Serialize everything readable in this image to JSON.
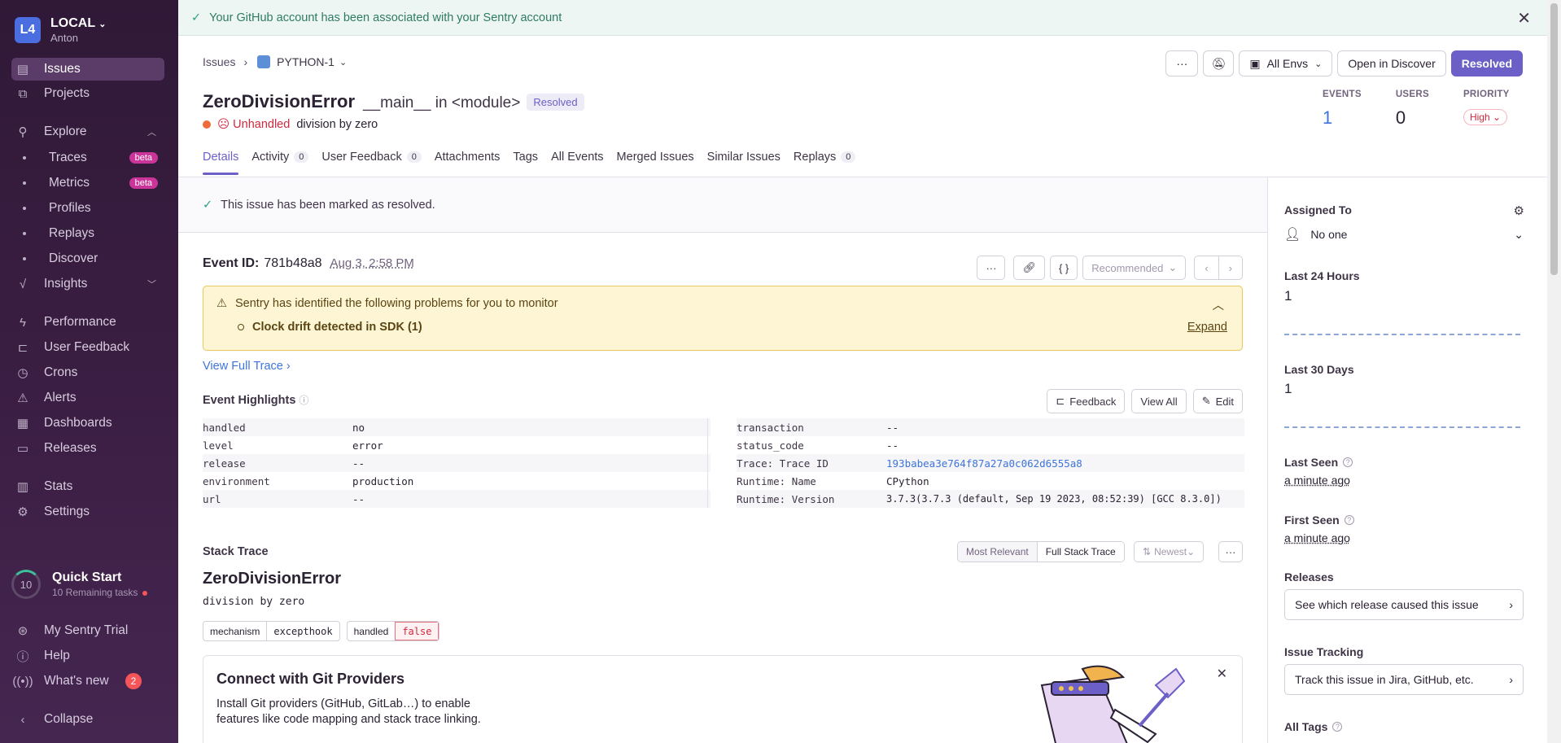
{
  "org": {
    "badge": "L4",
    "name": "LOCAL",
    "user": "Anton"
  },
  "nav": {
    "issues": "Issues",
    "projects": "Projects",
    "explore": "Explore",
    "traces": "Traces",
    "metrics": "Metrics",
    "profiles": "Profiles",
    "replays": "Replays",
    "discover": "Discover",
    "beta": "beta",
    "insights": "Insights",
    "performance": "Performance",
    "user_feedback": "User Feedback",
    "crons": "Crons",
    "alerts": "Alerts",
    "dashboards": "Dashboards",
    "releases": "Releases",
    "stats": "Stats",
    "settings": "Settings",
    "quick_start": "Quick Start",
    "quick_count": "10",
    "quick_remaining": "10 Remaining tasks",
    "trial": "My Sentry Trial",
    "help": "Help",
    "whats_new": "What's new",
    "whats_new_count": "2",
    "collapse": "Collapse"
  },
  "banner": {
    "text": "Your GitHub account has been associated with your Sentry account"
  },
  "breadcrumb": {
    "root": "Issues",
    "project": "PYTHON-1"
  },
  "issue": {
    "title": "ZeroDivisionError",
    "culprit": "__main__ in <module>",
    "status_pill": "Resolved",
    "unhandled": "Unhandled",
    "message": "division by zero"
  },
  "header_buttons": {
    "more": "···",
    "env": "All Envs",
    "discover": "Open in Discover",
    "resolved": "Resolved"
  },
  "stats": {
    "events_label": "EVENTS",
    "events": "1",
    "users_label": "USERS",
    "users": "0",
    "priority_label": "PRIORITY",
    "priority": "High"
  },
  "tabs": [
    {
      "label": "Details"
    },
    {
      "label": "Activity",
      "count": "0"
    },
    {
      "label": "User Feedback",
      "count": "0"
    },
    {
      "label": "Attachments"
    },
    {
      "label": "Tags"
    },
    {
      "label": "All Events"
    },
    {
      "label": "Merged Issues"
    },
    {
      "label": "Similar Issues"
    },
    {
      "label": "Replays",
      "count": "0"
    }
  ],
  "resolved_notice": "This issue has been marked as resolved.",
  "event": {
    "label": "Event ID:",
    "id": "781b48a8",
    "date": "Aug 3, 2:58 PM",
    "recommended": "Recommended"
  },
  "warning": {
    "title": "Sentry has identified the following problems for you to monitor",
    "item": "Clock drift detected in SDK (1)",
    "expand": "Expand"
  },
  "view_trace": "View Full Trace",
  "highlights": {
    "title": "Event Highlights",
    "feedback": "Feedback",
    "view_all": "View All",
    "edit": "Edit",
    "left": [
      {
        "k": "handled",
        "v": "no"
      },
      {
        "k": "level",
        "v": "error"
      },
      {
        "k": "release",
        "v": "--"
      },
      {
        "k": "environment",
        "v": "production"
      },
      {
        "k": "url",
        "v": "--"
      }
    ],
    "right": [
      {
        "k": "transaction",
        "v": "--"
      },
      {
        "k": "status_code",
        "v": "--"
      },
      {
        "k": "Trace: Trace ID",
        "v": "193babea3e764f87a27a0c062d6555a8"
      },
      {
        "k": "Runtime: Name",
        "v": "CPython"
      },
      {
        "k": "Runtime: Version",
        "v": "3.7.3(3.7.3 (default, Sep 19 2023, 08:52:39) [GCC 8.3.0])"
      }
    ]
  },
  "stack": {
    "title": "Stack Trace",
    "most_relevant": "Most Relevant",
    "full": "Full Stack Trace",
    "newest": "Newest",
    "exception": "ZeroDivisionError",
    "message": "division by zero",
    "mechanism_k": "mechanism",
    "mechanism_v": "excepthook",
    "handled_k": "handled",
    "handled_v": "false"
  },
  "git": {
    "title": "Connect with Git Providers",
    "body": "Install Git providers (GitHub, GitLab…) to enable features like code mapping and stack trace linking."
  },
  "sidebar_right": {
    "assigned_to": "Assigned To",
    "assignee": "No one",
    "last24": "Last 24 Hours",
    "last24_val": "1",
    "last30": "Last 30 Days",
    "last30_val": "1",
    "last_seen": "Last Seen",
    "last_seen_val": "a minute ago",
    "first_seen": "First Seen",
    "first_seen_val": "a minute ago",
    "releases": "Releases",
    "releases_btn": "See which release caused this issue",
    "tracking": "Issue Tracking",
    "tracking_btn": "Track this issue in Jira, GitHub, etc.",
    "all_tags": "All Tags"
  }
}
